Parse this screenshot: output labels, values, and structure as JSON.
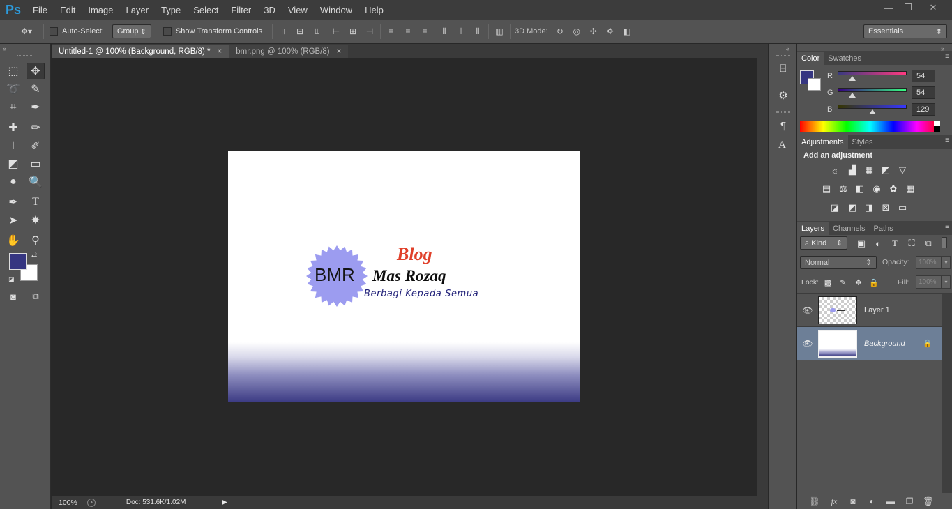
{
  "app": {
    "logo": "Ps"
  },
  "menu": [
    "File",
    "Edit",
    "Image",
    "Layer",
    "Type",
    "Select",
    "Filter",
    "3D",
    "View",
    "Window",
    "Help"
  ],
  "window_controls": {
    "minimize": "—",
    "restore": "❐",
    "close": "✕"
  },
  "options_bar": {
    "auto_select_label": "Auto-Select:",
    "auto_select_value": "Group",
    "show_transform_label": "Show Transform Controls",
    "mode_3d_label": "3D Mode:",
    "workspace": "Essentials"
  },
  "tabs": [
    {
      "label": "Untitled-1 @ 100% (Background, RGB/8) *",
      "active": true
    },
    {
      "label": "bmr.png @ 100% (RGB/8)",
      "active": false
    }
  ],
  "colors": {
    "foreground": "#363681",
    "background": "#ffffff",
    "accent_selection": "#6d7f97"
  },
  "canvas": {
    "logo_badge": "BMR",
    "logo_title": "Blog",
    "logo_name": "Mas Rozaq",
    "logo_tagline": "Berbagi Kepada Semua"
  },
  "status": {
    "zoom": "100%",
    "doc": "Doc: 531.6K/1.02M"
  },
  "color_panel": {
    "tabs": [
      "Color",
      "Swatches"
    ],
    "channels": [
      {
        "label": "R",
        "value": "54"
      },
      {
        "label": "G",
        "value": "54"
      },
      {
        "label": "B",
        "value": "129"
      }
    ]
  },
  "adjustments_panel": {
    "tabs": [
      "Adjustments",
      "Styles"
    ],
    "heading": "Add an adjustment"
  },
  "layers_panel": {
    "tabs": [
      "Layers",
      "Channels",
      "Paths"
    ],
    "filter": "Kind",
    "blend_mode": "Normal",
    "opacity_label": "Opacity:",
    "opacity_value": "100%",
    "lock_label": "Lock:",
    "fill_label": "Fill:",
    "fill_value": "100%",
    "layers": [
      {
        "name": "Layer 1",
        "selected": false
      },
      {
        "name": "Background",
        "selected": true
      }
    ]
  }
}
